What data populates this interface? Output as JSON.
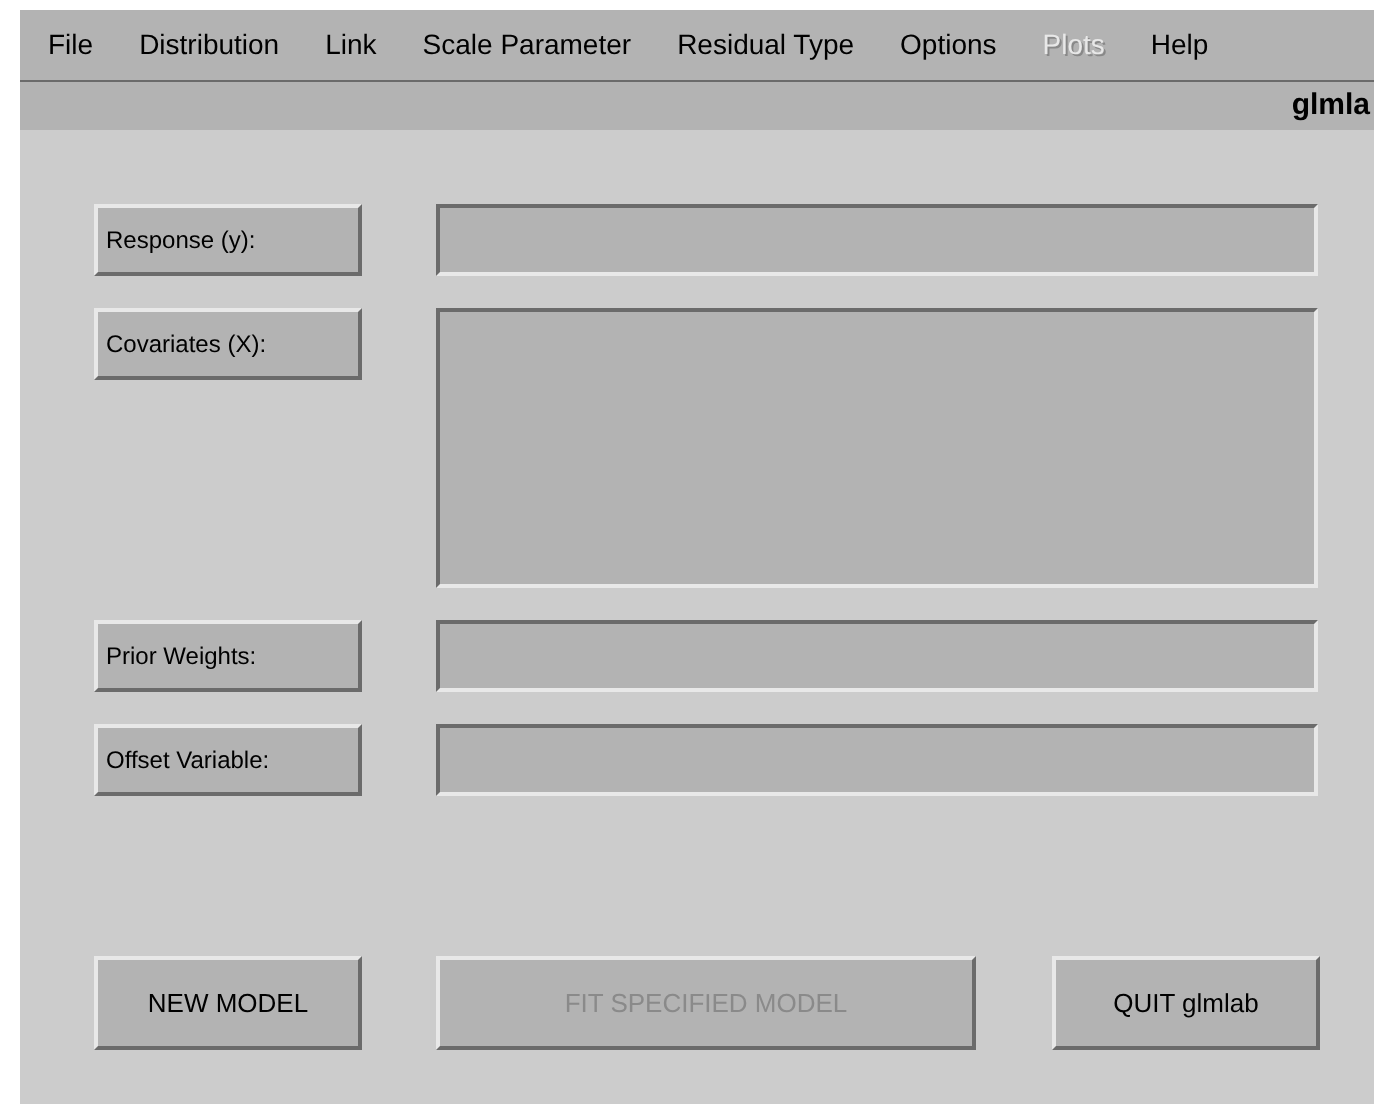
{
  "menu": [
    {
      "label": "File",
      "disabled": false
    },
    {
      "label": "Distribution",
      "disabled": false
    },
    {
      "label": "Link",
      "disabled": false
    },
    {
      "label": "Scale Parameter",
      "disabled": false
    },
    {
      "label": "Residual Type",
      "disabled": false
    },
    {
      "label": "Options",
      "disabled": false
    },
    {
      "label": "Plots",
      "disabled": true
    },
    {
      "label": "Help",
      "disabled": false
    }
  ],
  "title": "glmla",
  "fields": [
    {
      "label": "Response (y):",
      "kind": "single"
    },
    {
      "label": "Covariates (X):",
      "kind": "multi"
    },
    {
      "label": "Prior Weights:",
      "kind": "single"
    },
    {
      "label": "Offset Variable:",
      "kind": "single"
    }
  ],
  "buttons": [
    {
      "label": "NEW MODEL",
      "disabled": false,
      "kind": "small"
    },
    {
      "label": "FIT SPECIFIED MODEL",
      "disabled": true,
      "kind": "wide"
    },
    {
      "label": "QUIT glmlab",
      "disabled": false,
      "kind": "small"
    }
  ]
}
